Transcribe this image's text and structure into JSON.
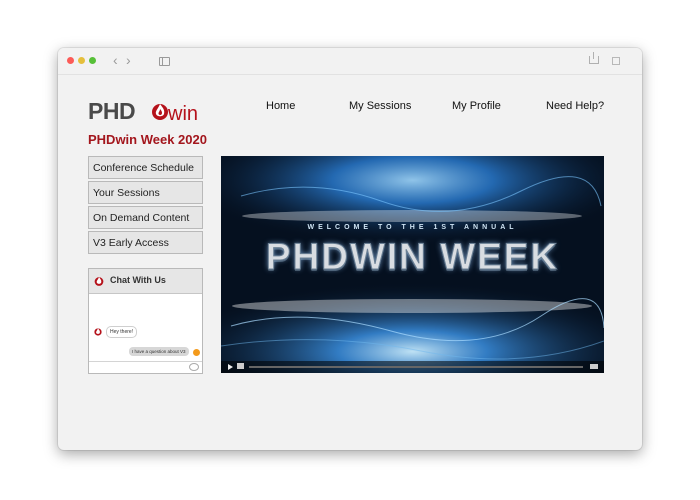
{
  "logo": {
    "phd": "PHD",
    "win": "win"
  },
  "nav": [
    "Home",
    "My Sessions",
    "My Profile",
    "Need Help?"
  ],
  "page_title": "PHDwin Week 2020",
  "menu": [
    "Conference Schedule",
    "Your Sessions",
    "On Demand Content",
    "V3 Early Access"
  ],
  "chat": {
    "title": "Chat With Us",
    "message_in": "Hey there!",
    "message_out": "I have a question about V3"
  },
  "video": {
    "subtitle": "WELCOME TO THE 1ST ANNUAL",
    "title": "PHDWIN WEEK"
  },
  "colors": {
    "brand_red": "#b5121b",
    "title_red": "#a3161d",
    "user_orange": "#f39a1c"
  }
}
